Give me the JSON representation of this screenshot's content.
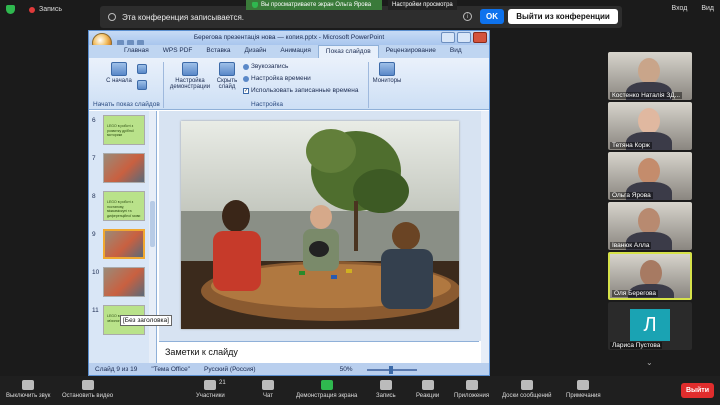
{
  "topbar": {
    "record_label": "Запись",
    "view_label": "Вид",
    "enter_label": "Вход",
    "share_banner": "Вы просматриваете экран Ольга Ярова",
    "share_settings": "Настройки просмотра",
    "recording_notice": "Эта конференция записывается.",
    "info_glyph": "i",
    "ok_label": "OK",
    "leave_label": "Выйти из конференции"
  },
  "ppt": {
    "window_title": "Берегова презентація нова — копия.pptx - Microsoft PowerPoint",
    "tabs": [
      "Главная",
      "WPS PDF",
      "Вставка",
      "Дизайн",
      "Анимация",
      "Показ слайдов",
      "Рецензирование",
      "Вид"
    ],
    "active_tab": "Показ слайдов",
    "ribbon": {
      "from_start": "С начала",
      "group_start": "Начать показ слайдов",
      "setup_show": "Настройка демонстрации",
      "hide_slide": "Скрыть слайд",
      "record_narration": "Звукозапись",
      "rehearse": "Настройка времени",
      "use_timings": "Использовать записанные времена",
      "group_setup": "Настройка",
      "monitors": "Мониторы"
    },
    "thumbnails": [
      {
        "num": "6",
        "kind": "green",
        "text": "LEGO в роботі з розвитку дрібної моторики"
      },
      {
        "num": "7",
        "kind": "photo",
        "text": ""
      },
      {
        "num": "8",
        "kind": "green",
        "text": "LEGO в роботі з постанову, міжкаміскуні та диференційної мови"
      },
      {
        "num": "9",
        "kind": "photo",
        "text": ""
      },
      {
        "num": "10",
        "kind": "photo",
        "text": ""
      },
      {
        "num": "11",
        "kind": "green",
        "text": "LEGO в розвитку зв'язного мовлення"
      }
    ],
    "tooltip": "[Без заголовка]",
    "notes_placeholder": "Заметки к слайду",
    "status": {
      "slide_count": "Слайд 9 из 19",
      "theme": "\"Тема Office\"",
      "language": "Русский (Россия)",
      "zoom": "50%"
    }
  },
  "participants": [
    {
      "name": "Костенко Наталія ЗД...",
      "muted": true
    },
    {
      "name": "Тетяна Корж",
      "muted": false
    },
    {
      "name": "Ольга Ярова",
      "muted": true
    },
    {
      "name": "Іванюк Алла",
      "muted": false
    },
    {
      "name": "Оля Берегова",
      "muted": false
    },
    {
      "name": "Лариса Пустова",
      "muted": true,
      "initial": "Л"
    }
  ],
  "bottom": {
    "mute": "Выключить звук",
    "video": "Остановить видео",
    "participants": "Участники",
    "participants_count": "21",
    "chat": "Чат",
    "share": "Демонстрация экрана",
    "record": "Запись",
    "reactions": "Реакции",
    "apps": "Приложения",
    "whiteboards": "Доски сообщений",
    "notes": "Примечания",
    "end": "Выйти"
  }
}
